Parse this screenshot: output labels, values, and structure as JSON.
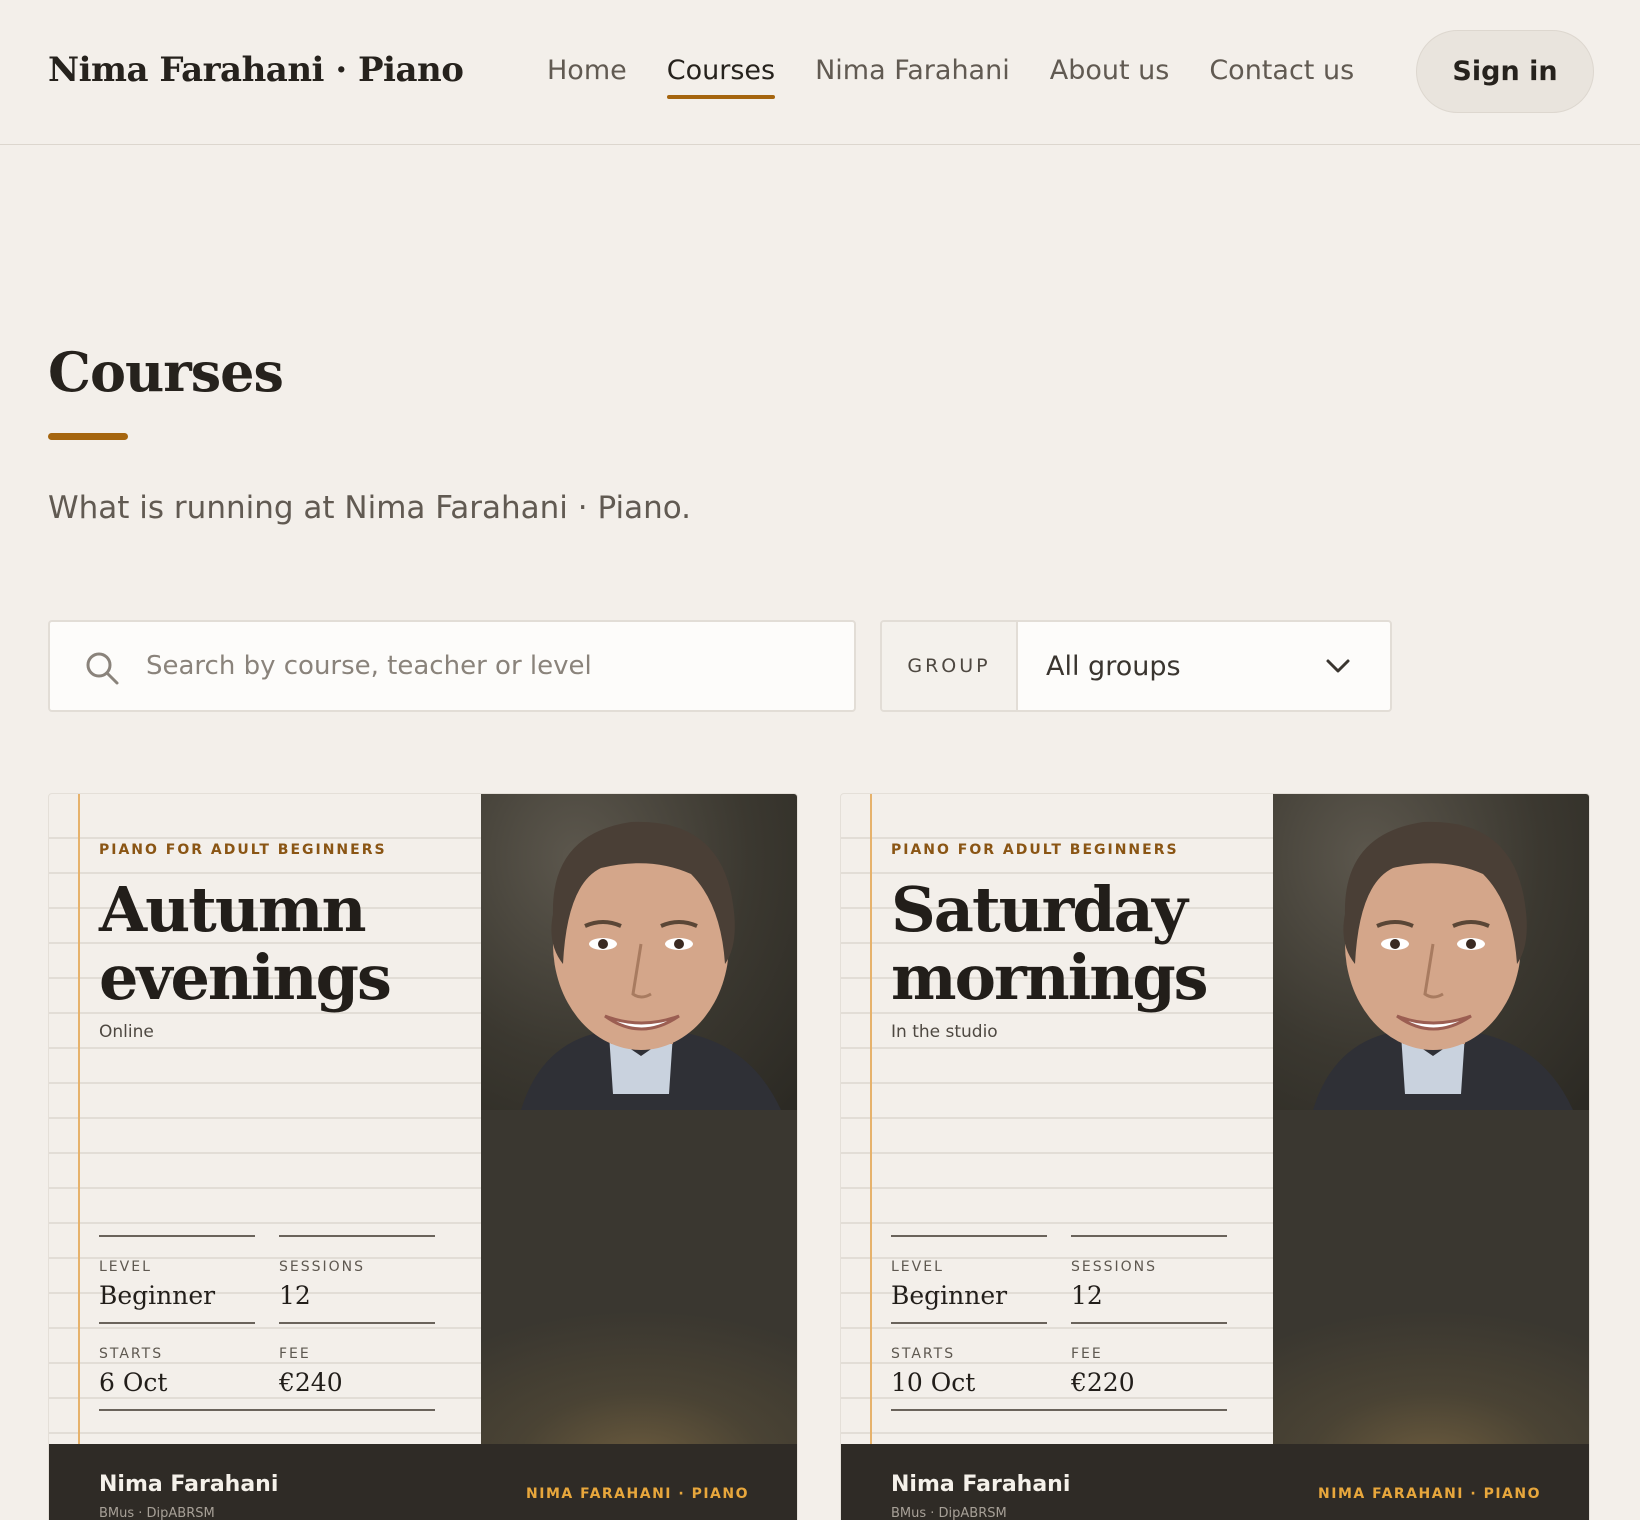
{
  "header": {
    "brand": "Nima Farahani · Piano",
    "nav": [
      "Home",
      "Courses",
      "Nima Farahani",
      "About us",
      "Contact us"
    ],
    "active_nav": "Courses",
    "signin_label": "Sign in"
  },
  "page": {
    "title": "Courses",
    "subtitle": "What is running at Nima Farahani · Piano."
  },
  "filters": {
    "search_placeholder": "Search by course, teacher or level",
    "search_value": "",
    "group_label": "GROUP",
    "group_selected": "All groups"
  },
  "courses": [
    {
      "kicker": "PIANO FOR ADULT BEGINNERS",
      "title": "Autumn evenings",
      "mode": "Online",
      "level_label": "LEVEL",
      "level": "Beginner",
      "sessions_label": "SESSIONS",
      "sessions": "12",
      "starts_label": "STARTS",
      "starts": "6 Oct",
      "fee_label": "FEE",
      "fee": "€240",
      "teacher": "Nima Farahani",
      "credentials": "BMus · DipABRSM",
      "footer_brand": "NIMA FARAHANI · PIANO"
    },
    {
      "kicker": "PIANO FOR ADULT BEGINNERS",
      "title": "Saturday mornings",
      "mode": "In the studio",
      "level_label": "LEVEL",
      "level": "Beginner",
      "sessions_label": "SESSIONS",
      "sessions": "12",
      "starts_label": "STARTS",
      "starts": "10 Oct",
      "fee_label": "FEE",
      "fee": "€220",
      "teacher": "Nima Farahani",
      "credentials": "BMus · DipABRSM",
      "footer_brand": "NIMA FARAHANI · PIANO"
    }
  ],
  "colors": {
    "accent": "#a5650f",
    "background": "#f3efea",
    "footer_dark": "#2f2b26",
    "footer_brand": "#e8a73c"
  }
}
